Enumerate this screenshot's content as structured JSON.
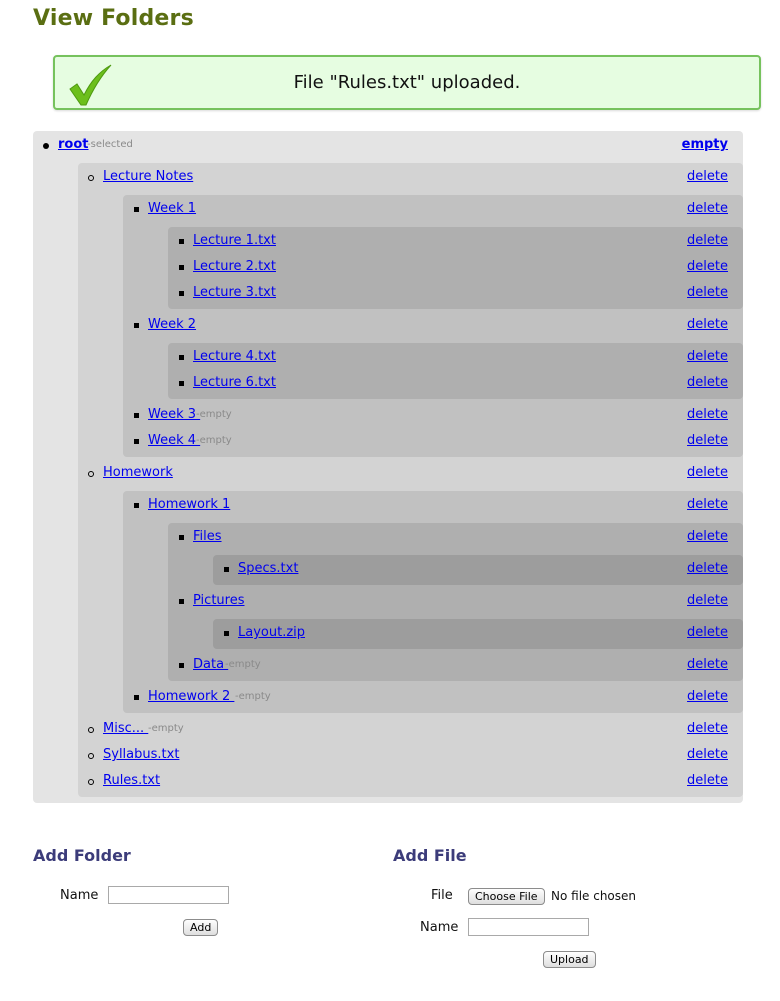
{
  "page": {
    "title": "View Folders"
  },
  "notice": {
    "message": "File \"Rules.txt\" uploaded.",
    "icon": "checkmark-icon",
    "color": "#76c25d"
  },
  "tree": {
    "root": {
      "name": "root",
      "tag": "-selected",
      "action": "empty"
    },
    "rows": [
      {
        "name": "Lecture Notes",
        "tag": "",
        "action": "delete"
      },
      {
        "name": "Week 1",
        "tag": "",
        "action": "delete"
      },
      {
        "name": "Lecture 1.txt",
        "tag": "",
        "action": "delete"
      },
      {
        "name": "Lecture 2.txt",
        "tag": "",
        "action": "delete"
      },
      {
        "name": "Lecture 3.txt",
        "tag": "",
        "action": "delete"
      },
      {
        "name": "Week 2",
        "tag": "",
        "action": "delete"
      },
      {
        "name": "Lecture 4.txt",
        "tag": "",
        "action": "delete"
      },
      {
        "name": "Lecture 6.txt",
        "tag": "",
        "action": "delete"
      },
      {
        "name": "Week 3 ",
        "tag": "-empty",
        "action": "delete"
      },
      {
        "name": "Week 4 ",
        "tag": "-empty",
        "action": "delete"
      },
      {
        "name": "Homework",
        "tag": "",
        "action": "delete"
      },
      {
        "name": "Homework 1",
        "tag": "",
        "action": "delete"
      },
      {
        "name": "Files",
        "tag": "",
        "action": "delete"
      },
      {
        "name": "Specs.txt",
        "tag": "",
        "action": "delete"
      },
      {
        "name": "Pictures",
        "tag": "",
        "action": "delete"
      },
      {
        "name": "Layout.zip",
        "tag": "",
        "action": "delete"
      },
      {
        "name": "Data ",
        "tag": "-empty",
        "action": "delete"
      },
      {
        "name": "Homework 2 ",
        "tag": "-empty",
        "action": "delete"
      },
      {
        "name": "Misc... ",
        "tag": "-empty",
        "action": "delete"
      },
      {
        "name": "Syllabus.txt",
        "tag": "",
        "action": "delete"
      },
      {
        "name": "Rules.txt",
        "tag": "",
        "action": "delete"
      }
    ]
  },
  "add_folder": {
    "title": "Add Folder",
    "name_label": "Name",
    "name_value": "",
    "button": "Add"
  },
  "add_file": {
    "title": "Add File",
    "file_label": "File",
    "choose_button": "Choose File",
    "no_file": "No file chosen",
    "name_label": "Name",
    "name_value": "",
    "button": "Upload"
  }
}
